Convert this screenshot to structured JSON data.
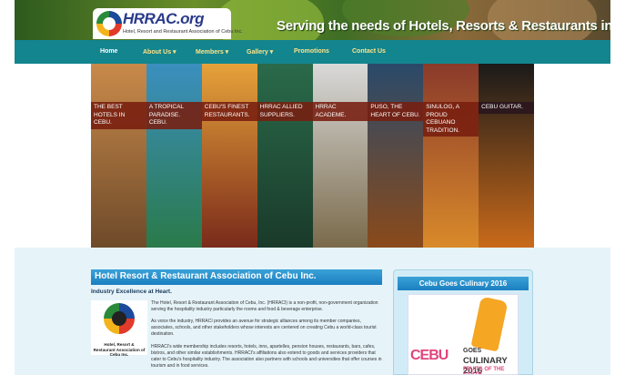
{
  "header": {
    "logo_text": "HRRAC.org",
    "logo_sub": "Hotel, Resort and Restaurant Association of Cebu Inc.",
    "tagline": "Serving the needs of Hotels, Resorts & Restaurants in Cebu."
  },
  "nav": {
    "items": [
      {
        "label": "Home"
      },
      {
        "label": "About Us ▾"
      },
      {
        "label": "Members ▾"
      },
      {
        "label": "Gallery ▾"
      },
      {
        "label": "Promotions"
      },
      {
        "label": "Contact Us"
      }
    ]
  },
  "slider": {
    "slides": [
      {
        "caption": "The best hotels in Cebu.",
        "color_top": "#c98a4a",
        "color_bottom": "#6e4a2a"
      },
      {
        "caption": "A tropical paradise. Cebu.",
        "color_top": "#3b8fbf",
        "color_bottom": "#2a7a4a"
      },
      {
        "caption": "Cebu's finest restaurants.",
        "color_top": "#e6a23a",
        "color_bottom": "#7a2a1a"
      },
      {
        "caption": "HRRAC allied suppliers.",
        "color_top": "#2a6a4a",
        "color_bottom": "#1a3a2a"
      },
      {
        "caption": "HRRAC Academe.",
        "color_top": "#d9d9d9",
        "color_bottom": "#7a6a4a"
      },
      {
        "caption": "Puso, the heart of Cebu.",
        "color_top": "#2a4a6a",
        "color_bottom": "#8a4a1a"
      },
      {
        "caption": "Sinulog, a proud Cebuano tradition.",
        "color_top": "#8a3a2a",
        "color_bottom": "#d98a2a"
      },
      {
        "caption": "Cebu guitar.",
        "color_top": "#1a1a1a",
        "color_bottom": "#c96a1a"
      }
    ]
  },
  "about": {
    "title": "Hotel Resort & Restaurant Association of Cebu Inc.",
    "subtitle": "Industry Excellence at Heart.",
    "logo_caption": "Hotel, Resort & Restaurant Association of Cebu Inc.",
    "p1": "The Hotel, Resort & Restaurant Association of Cebu, Inc. (HRRACI) is a non-profit, non-government organization serving the hospitality industry particularly the rooms and food & beverage enterprise.",
    "p2": "As voice the industry, HRRACI provides an avenue for strategic alliances among its member companies, associates, schools, and other stakeholders whose interests are centered on creating Cebu a world-class tourist destination.",
    "p3": "HRRACI's wide membership includes resorts, hotels, inns, apartelles, pension houses, restaurants, bars, cafes, bistros, and other similar establishments. HRRACI's affiliations also extend to goods and services providers that cater to Cebu's hospitality industry. The association also partners with schools and universities that offer courses in tourism and in food services."
  },
  "sidebar": {
    "title": "Cebu Goes Culinary 2016",
    "cebu": "CEBU",
    "goes": "GOES",
    "culinary": "CULINARY 2016",
    "fruits": "FRUITS OF THE EARTH"
  }
}
